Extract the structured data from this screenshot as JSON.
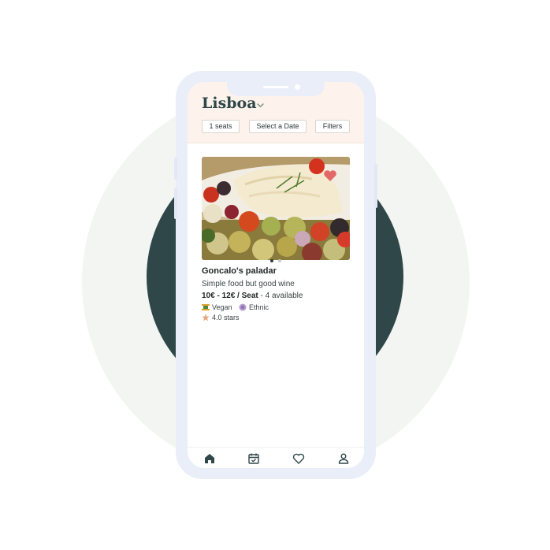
{
  "header": {
    "city": "Lisboa",
    "filters": {
      "seats": "1 seats",
      "date": "Select a Date",
      "filters": "Filters"
    }
  },
  "listing": {
    "name": "Goncalo's paladar",
    "description": "Simple food but good wine",
    "price": "10€ - 12€ / Seat",
    "availability": " - 4 available",
    "tags": [
      {
        "label": "Vegan",
        "icon": "vegan-icon"
      },
      {
        "label": "Ethnic",
        "icon": "ethnic-icon"
      }
    ],
    "rating": "4.0 stars",
    "carousel": {
      "current": 1,
      "total": 2
    }
  },
  "tabbar": {
    "items": [
      "home-icon",
      "calendar-icon",
      "heart-icon",
      "profile-icon"
    ],
    "active": "home-icon"
  },
  "colors": {
    "brand_dark": "#2f4749",
    "header_bg": "#fdf3ec",
    "phone_frame": "#e9eef9",
    "favorite": "#e05a5a"
  }
}
